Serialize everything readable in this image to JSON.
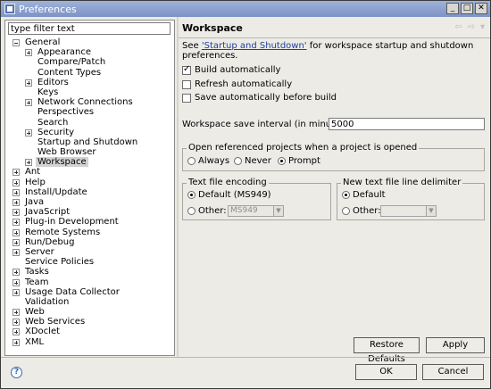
{
  "window": {
    "title": "Preferences"
  },
  "filter": {
    "value": "type filter text"
  },
  "tree": [
    {
      "label": "General",
      "indent": 0,
      "exp": "minus"
    },
    {
      "label": "Appearance",
      "indent": 1,
      "exp": "plus"
    },
    {
      "label": "Compare/Patch",
      "indent": 1,
      "exp": ""
    },
    {
      "label": "Content Types",
      "indent": 1,
      "exp": ""
    },
    {
      "label": "Editors",
      "indent": 1,
      "exp": "plus"
    },
    {
      "label": "Keys",
      "indent": 1,
      "exp": ""
    },
    {
      "label": "Network Connections",
      "indent": 1,
      "exp": "plus"
    },
    {
      "label": "Perspectives",
      "indent": 1,
      "exp": ""
    },
    {
      "label": "Search",
      "indent": 1,
      "exp": ""
    },
    {
      "label": "Security",
      "indent": 1,
      "exp": "plus"
    },
    {
      "label": "Startup and Shutdown",
      "indent": 1,
      "exp": ""
    },
    {
      "label": "Web Browser",
      "indent": 1,
      "exp": ""
    },
    {
      "label": "Workspace",
      "indent": 1,
      "exp": "plus",
      "selected": true
    },
    {
      "label": "Ant",
      "indent": 0,
      "exp": "plus"
    },
    {
      "label": "Help",
      "indent": 0,
      "exp": "plus"
    },
    {
      "label": "Install/Update",
      "indent": 0,
      "exp": "plus"
    },
    {
      "label": "Java",
      "indent": 0,
      "exp": "plus"
    },
    {
      "label": "JavaScript",
      "indent": 0,
      "exp": "plus"
    },
    {
      "label": "Plug-in Development",
      "indent": 0,
      "exp": "plus"
    },
    {
      "label": "Remote Systems",
      "indent": 0,
      "exp": "plus"
    },
    {
      "label": "Run/Debug",
      "indent": 0,
      "exp": "plus"
    },
    {
      "label": "Server",
      "indent": 0,
      "exp": "plus"
    },
    {
      "label": "Service Policies",
      "indent": 0,
      "exp": ""
    },
    {
      "label": "Tasks",
      "indent": 0,
      "exp": "plus"
    },
    {
      "label": "Team",
      "indent": 0,
      "exp": "plus"
    },
    {
      "label": "Usage Data Collector",
      "indent": 0,
      "exp": "plus"
    },
    {
      "label": "Validation",
      "indent": 0,
      "exp": ""
    },
    {
      "label": "Web",
      "indent": 0,
      "exp": "plus"
    },
    {
      "label": "Web Services",
      "indent": 0,
      "exp": "plus"
    },
    {
      "label": "XDoclet",
      "indent": 0,
      "exp": "plus"
    },
    {
      "label": "XML",
      "indent": 0,
      "exp": "plus"
    }
  ],
  "page": {
    "title": "Workspace",
    "desc_before": "See ",
    "desc_link": "'Startup and Shutdown'",
    "desc_after": " for workspace startup and shutdown preferences.",
    "build_auto": "Build automatically",
    "refresh_auto": "Refresh automatically",
    "save_auto": "Save automatically before build",
    "interval_label": "Workspace save interval (in minutes):",
    "interval_value": "5000",
    "open_group": "Open referenced projects when a project is opened",
    "always": "Always",
    "never": "Never",
    "prompt": "Prompt",
    "encoding_group": "Text file encoding",
    "default_encoding": "Default (MS949)",
    "other": "Other:",
    "encoding_combo": "MS949",
    "delimiter_group": "New text file line delimiter",
    "default": "Default",
    "other2": "Other:",
    "restore_defaults": "Restore Defaults",
    "apply": "Apply"
  },
  "footer": {
    "ok": "OK",
    "cancel": "Cancel"
  },
  "nav_glyphs": {
    "back": "⇦",
    "forward": "⇨",
    "menu": "▾"
  }
}
